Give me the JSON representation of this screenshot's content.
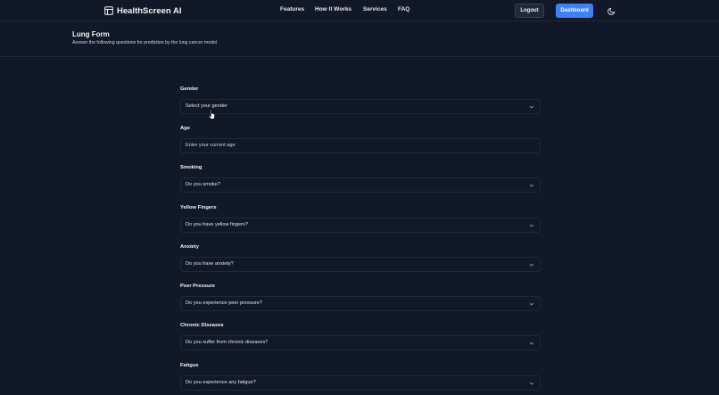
{
  "nav": {
    "brand": "HealthScreen AI",
    "links": [
      "Features",
      "How It Works",
      "Services",
      "FAQ"
    ],
    "logout": "Logout",
    "dashboard": "Dashboard"
  },
  "header": {
    "title": "Lung Form",
    "subtitle": "Answer the following questions for prediction by the lung cancer model"
  },
  "form": {
    "fields": [
      {
        "label": "Gender",
        "value": "Select your gender",
        "type": "select"
      },
      {
        "label": "Age",
        "value": "Enter your current age",
        "type": "input"
      },
      {
        "label": "Smoking",
        "value": "Do you smoke?",
        "type": "select"
      },
      {
        "label": "Yellow Fingers",
        "value": "Do you have yellow fingers?",
        "type": "select"
      },
      {
        "label": "Anxiety",
        "value": "Do you have anxiety?",
        "type": "select"
      },
      {
        "label": "Peer Pressure",
        "value": "Do you experience peer pressure?",
        "type": "select"
      },
      {
        "label": "Chronic Diseases",
        "value": "Do you suffer from chronic diseases?",
        "type": "select"
      },
      {
        "label": "Fatigue",
        "value": "Do you experience any fatigue?",
        "type": "select"
      }
    ]
  },
  "colors": {
    "background": "#111827",
    "accent": "#3b82f6",
    "border": "#1f2937"
  },
  "icons": {
    "brand": "layout-icon",
    "theme": "moon-icon",
    "dropdown": "chevron-down-icon",
    "cursor": "hand-pointer-icon"
  }
}
